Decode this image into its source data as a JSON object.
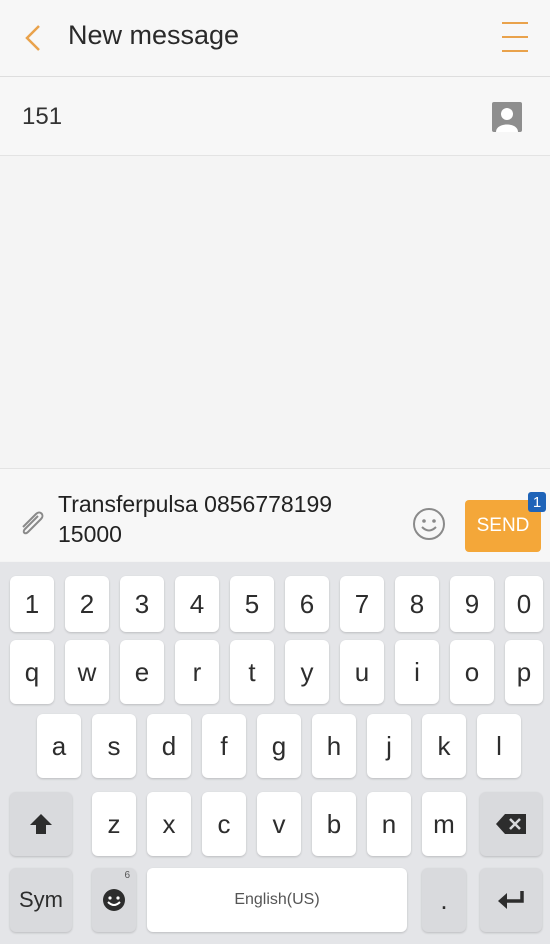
{
  "header": {
    "title": "New message",
    "back_icon": "chevron-left-icon",
    "menu_icon": "hamburger-menu-icon",
    "accent_color": "#e9a24b"
  },
  "recipient": {
    "number": "151",
    "contact_icon": "contact-picker-icon"
  },
  "composer": {
    "message_text": "Transferpulsa 0856778199\n15000",
    "attach_icon": "paperclip-icon",
    "emoji_icon": "smiley-icon",
    "send_label": "SEND",
    "send_badge": "1",
    "send_color": "#f4a739"
  },
  "keyboard": {
    "row_numbers": [
      "1",
      "2",
      "3",
      "4",
      "5",
      "6",
      "7",
      "8",
      "9",
      "0"
    ],
    "row_top": [
      "q",
      "w",
      "e",
      "r",
      "t",
      "y",
      "u",
      "i",
      "o",
      "p"
    ],
    "row_middle": [
      "a",
      "s",
      "d",
      "f",
      "g",
      "h",
      "j",
      "k",
      "l"
    ],
    "row_bottom": [
      "z",
      "x",
      "c",
      "v",
      "b",
      "n",
      "m"
    ],
    "shift_icon": "shift-arrow-icon",
    "backspace_icon": "backspace-icon",
    "sym_label": "Sym",
    "emoji_key_icon": "emoji-key-icon",
    "emoji_key_hint": "6",
    "space_label": "English(US)",
    "period_label": ".",
    "enter_icon": "enter-arrow-icon"
  }
}
